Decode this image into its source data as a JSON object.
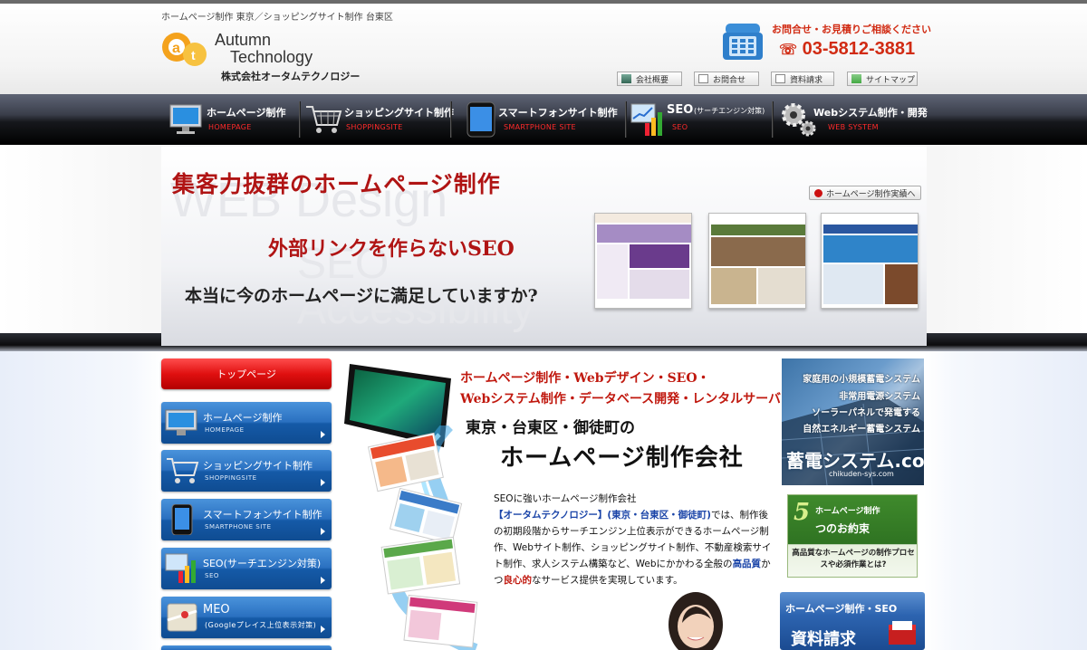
{
  "header": {
    "tagline": "ホームページ制作 東京／ショッピングサイト制作 台東区",
    "logo_en_line1": "Autumn",
    "logo_en_line2": "Technology",
    "logo_jp": "株式会社オータムテクノロジー",
    "contact_label": "お問合せ・お見積りご相談ください",
    "phone": "03-5812-3881",
    "util_links": [
      "会社概要",
      "お問合せ",
      "資料請求",
      "サイトマップ"
    ]
  },
  "nav": [
    {
      "jp": "ホームページ制作",
      "en": "HOMEPAGE",
      "icon": "monitor-icon"
    },
    {
      "jp": "ショッピングサイト制作",
      "en": "SHOPPINGSITE",
      "icon": "shopping-cart-icon"
    },
    {
      "jp": "スマートフォンサイト制作",
      "en": "SMARTPHONE SITE",
      "icon": "smartphone-icon"
    },
    {
      "jp": "SEO",
      "jp_sub": "(サーチエンジン対策)",
      "en": "SEO",
      "icon": "bar-chart-icon"
    },
    {
      "jp": "Webシステム制作・開発",
      "en": "WEB SYSTEM",
      "icon": "gears-icon"
    }
  ],
  "hero": {
    "headline1": "集客力抜群のホームページ制作",
    "headline2": "外部リンクを作らないSEO",
    "headline3": "本当に今のホームページに満足していますか?",
    "works_button": "ホームページ制作実績へ",
    "watermark": [
      "WEB Design",
      "SEO",
      "Accessibility"
    ]
  },
  "sidebar": {
    "top": "トップページ",
    "items": [
      {
        "jp": "ホームページ制作",
        "en": "HOMEPAGE",
        "icon": "monitor-icon"
      },
      {
        "jp": "ショッピングサイト制作",
        "en": "SHOPPINGSITE",
        "icon": "shopping-cart-icon"
      },
      {
        "jp": "スマートフォンサイト制作",
        "en": "SMARTPHONE SITE",
        "icon": "smartphone-icon"
      },
      {
        "jp": "SEO(サーチエンジン対策)",
        "en": "SEO",
        "icon": "bar-chart-icon"
      },
      {
        "jp": "MEO",
        "en": "(Googleプレイス上位表示対策)",
        "icon": "map-icon"
      }
    ]
  },
  "main": {
    "headline1": "ホームページ制作・Webデザイン・SEO・",
    "headline2": "Webシステム制作・データベース開発・レンタルサーバ",
    "headline3": "東京・台東区・御徒町の",
    "headline4": "ホームページ制作会社",
    "intro_lead": "SEOに強いホームページ制作会社",
    "intro_company": "【オータムテクノロジー】(東京・台東区・御徒町)",
    "intro_body": "では、制作後の初期段階からサーチエンジン上位表示ができるホームページ制作、Webサイト制作、ショッピングサイト制作、不動産検索サイト制作、求人システム構築など、Webにかかわる全般の",
    "intro_quality": "高品質",
    "intro_mid": "かつ",
    "intro_conscience": "良心的",
    "intro_tail": "なサービス提供を実現しています。"
  },
  "right": {
    "banner1_lines": [
      "家庭用の小規模蓄電システム",
      "非常用電源システム",
      "ソーラーパネルで発電する",
      "自然エネルギー蓄電システム"
    ],
    "banner1_big": "蓄電システム.com",
    "banner1_url": "chikuden-sys.com",
    "banner2_num": "5",
    "banner2_t1": "ホームページ制作",
    "banner2_t2": "つのお約束",
    "banner2_t3": "高品質なホームページの制作プロセスや必須作業とは?",
    "banner3_t1": "ホームページ制作・SEO",
    "banner3_t2": "資料請求"
  },
  "colors": {
    "accent_red": "#c0180e",
    "nav_dark": "#1c1e24",
    "side_blue": "#2a70c0"
  }
}
